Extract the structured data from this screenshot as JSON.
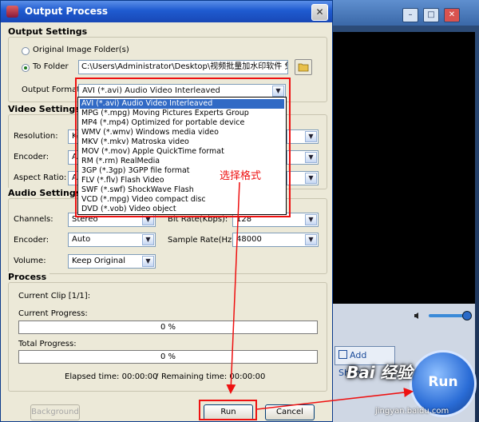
{
  "dialog": {
    "title": "Output Process",
    "output_settings": {
      "heading": "Output Settings",
      "original_folder_label": "Original Image Folder(s)",
      "to_folder_label": "To Folder",
      "folder_path": "C:\\Users\\Administrator\\Desktop\\视频批量加水印软件 免",
      "output_format_label": "Output Format :",
      "output_format_value": "AVI  (*.avi) Audio Video Interleaved"
    },
    "video_settings": {
      "heading": "Video Settings",
      "resolution_label": "Resolution:",
      "resolution_value": "Ke",
      "encoder_label": "Encoder:",
      "encoder_value": "A",
      "aspect_label": "Aspect Ratio:",
      "aspect_value": "A"
    },
    "audio_settings": {
      "heading": "Audio Settings",
      "channels_label": "Channels:",
      "channels_value": "Stereo",
      "bitrate_label": "Bit Rate(Kbps):",
      "bitrate_value": "128",
      "encoder_label": "Encoder:",
      "encoder_value": "Auto",
      "samplerate_label": "Sample Rate(Hz):",
      "samplerate_value": "48000",
      "volume_label": "Volume:",
      "volume_value": "Keep Original"
    },
    "process": {
      "heading": "Process",
      "current_clip": "Current Clip [1/1]:",
      "current_progress_label": "Current Progress:",
      "current_progress_text": "0 %",
      "current_progress_fraction": 0,
      "total_progress_label": "Total Progress:",
      "total_progress_text": "0 %",
      "total_progress_fraction": 0,
      "elapsed": "Elapsed time: 00:00:00",
      "separator": "/",
      "remaining": "Remaining time: 00:00:00"
    },
    "buttons": {
      "background": "Background",
      "run": "Run",
      "cancel": "Cancel"
    },
    "format_options": [
      "AVI  (*.avi) Audio Video Interleaved",
      "MPG  (*.mpg) Moving Pictures Experts Group",
      "MP4  (*.mp4) Optimized for portable device",
      "WMV  (*.wmv) Windows media video",
      "MKV  (*.mkv) Matroska video",
      "MOV  (*.mov) Apple QuickTime format",
      "RM   (*.rm) RealMedia",
      "3GP  (*.3gp) 3GPP file format",
      "FLV  (*.flv) Flash Video",
      "SWF  (*.swf) ShockWave Flash",
      "VCD  (*.mpg) Video compact disc",
      "DVD  (*.vob) Video object"
    ],
    "selected_format_index": 0
  },
  "background_app": {
    "add_shape": "Add Shape",
    "run": "Run",
    "minimize_glyph": "–",
    "maximize_glyph": "□",
    "close_glyph": "✕"
  },
  "annotation": {
    "select_format": "选择格式"
  },
  "watermark": {
    "brand": "Bai 经验",
    "url": "jingyan.baidu.com"
  },
  "colors": {
    "annotation_red": "#e11111",
    "selection_blue": "#316ac5",
    "title_blue": "#1f5bd0"
  }
}
